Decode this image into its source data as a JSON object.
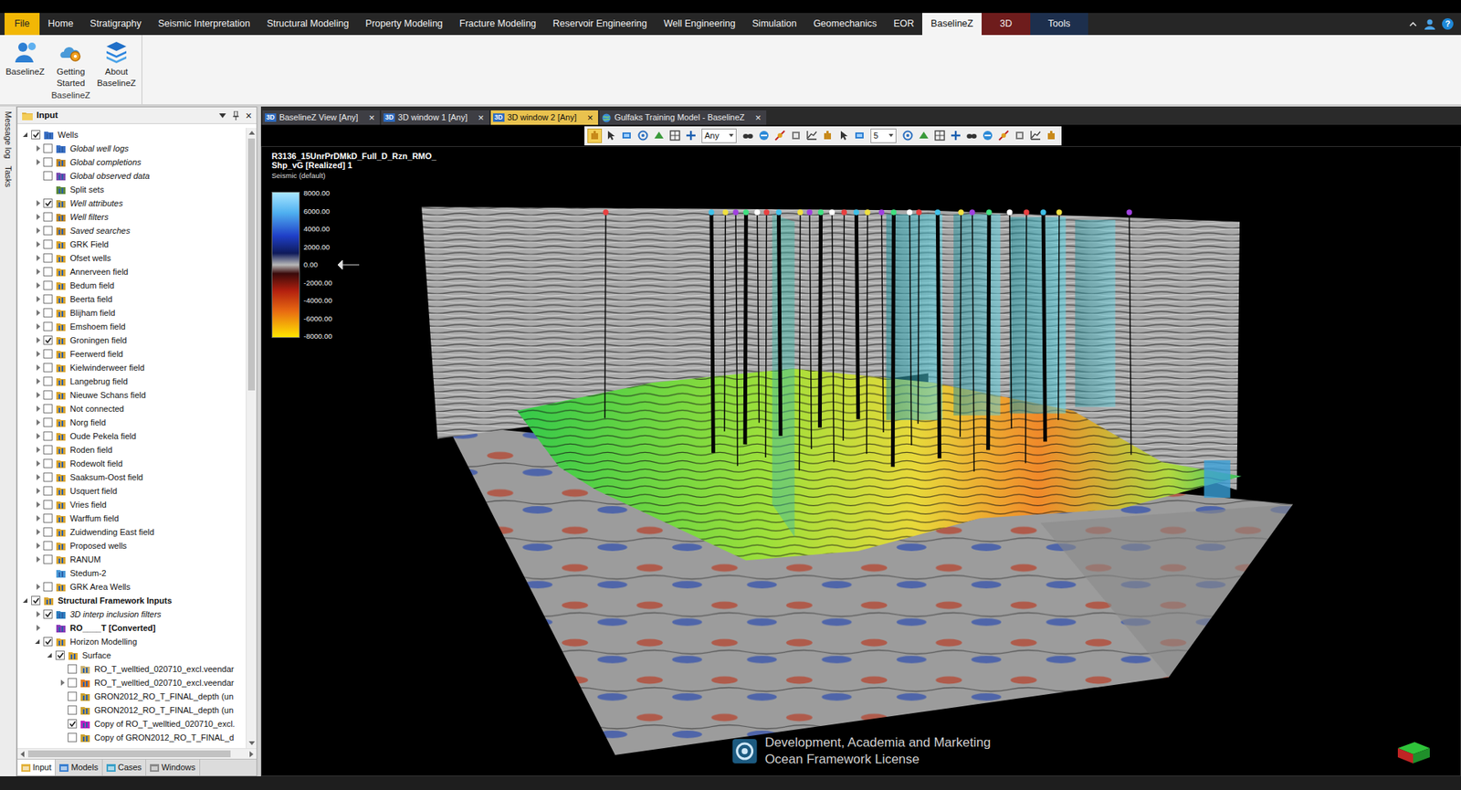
{
  "ribbon": {
    "tabs": [
      {
        "label": "File",
        "selected": false,
        "kind": "file"
      },
      {
        "label": "Home",
        "selected": false,
        "kind": "normal"
      },
      {
        "label": "Stratigraphy",
        "selected": false,
        "kind": "normal"
      },
      {
        "label": "Seismic Interpretation",
        "selected": false,
        "kind": "normal"
      },
      {
        "label": "Structural Modeling",
        "selected": false,
        "kind": "normal"
      },
      {
        "label": "Property Modeling",
        "selected": false,
        "kind": "normal"
      },
      {
        "label": "Fracture Modeling",
        "selected": false,
        "kind": "normal"
      },
      {
        "label": "Reservoir Engineering",
        "selected": false,
        "kind": "normal"
      },
      {
        "label": "Well Engineering",
        "selected": false,
        "kind": "normal"
      },
      {
        "label": "Simulation",
        "selected": false,
        "kind": "normal"
      },
      {
        "label": "Geomechanics",
        "selected": false,
        "kind": "normal"
      },
      {
        "label": "EOR",
        "selected": false,
        "kind": "normal"
      },
      {
        "label": "BaselineZ",
        "selected": true,
        "kind": "normal"
      },
      {
        "label": "3D",
        "selected": false,
        "kind": "context-red"
      },
      {
        "label": "Tools",
        "selected": false,
        "kind": "context-blue"
      }
    ],
    "help": "?",
    "group": {
      "label": "BaselineZ",
      "buttons": [
        {
          "label": "BaselineZ"
        },
        {
          "label": "Getting Started"
        },
        {
          "label": "About BaselineZ"
        }
      ]
    }
  },
  "side_strip": [
    "Message log",
    "Tasks"
  ],
  "input_panel": {
    "title": "Input",
    "close": "×",
    "tree": [
      {
        "label": "Wells",
        "depth": 0,
        "expander": "expanded",
        "has_checkbox": true,
        "checked": true,
        "style": "normal",
        "color": "#3a6fc4"
      },
      {
        "label": "Global well logs",
        "depth": 1,
        "expander": "collapsed",
        "has_checkbox": true,
        "checked": false,
        "style": "italic",
        "color": "#3a6fc4"
      },
      {
        "label": "Global completions",
        "depth": 1,
        "expander": "collapsed",
        "has_checkbox": true,
        "checked": false,
        "style": "italic",
        "color": "#c08a2a"
      },
      {
        "label": "Global observed data",
        "depth": 1,
        "expander": "none",
        "has_checkbox": true,
        "checked": false,
        "style": "italic",
        "color": "#7a4bb0"
      },
      {
        "label": "Split sets",
        "depth": 1,
        "expander": "none",
        "has_checkbox": false,
        "checked": false,
        "style": "normal",
        "color": "#5d8a3a"
      },
      {
        "label": "Well attributes",
        "depth": 1,
        "expander": "collapsed",
        "has_checkbox": true,
        "checked": true,
        "style": "italic",
        "color": "#c0a040"
      },
      {
        "label": "Well filters",
        "depth": 1,
        "expander": "collapsed",
        "has_checkbox": true,
        "checked": false,
        "style": "italic",
        "color": "#c08a2a"
      },
      {
        "label": "Saved searches",
        "depth": 1,
        "expander": "collapsed",
        "has_checkbox": true,
        "checked": false,
        "style": "italic",
        "color": "#c08a2a"
      },
      {
        "label": "GRK Field",
        "depth": 1,
        "expander": "collapsed",
        "has_checkbox": true,
        "checked": false,
        "style": "normal",
        "color": "#d9a531"
      },
      {
        "label": "Ofset wells",
        "depth": 1,
        "expander": "collapsed",
        "has_checkbox": true,
        "checked": false,
        "style": "normal",
        "color": "#d9a531"
      },
      {
        "label": "Annerveen field",
        "depth": 1,
        "expander": "collapsed",
        "has_checkbox": true,
        "checked": false,
        "style": "normal",
        "color": "#d9a531"
      },
      {
        "label": "Bedum field",
        "depth": 1,
        "expander": "collapsed",
        "has_checkbox": true,
        "checked": false,
        "style": "normal",
        "color": "#d9a531"
      },
      {
        "label": "Beerta field",
        "depth": 1,
        "expander": "collapsed",
        "has_checkbox": true,
        "checked": false,
        "style": "normal",
        "color": "#d9a531"
      },
      {
        "label": "Blijham field",
        "depth": 1,
        "expander": "collapsed",
        "has_checkbox": true,
        "checked": false,
        "style": "normal",
        "color": "#d9a531"
      },
      {
        "label": "Emshoem field",
        "depth": 1,
        "expander": "collapsed",
        "has_checkbox": true,
        "checked": false,
        "style": "normal",
        "color": "#d9a531"
      },
      {
        "label": "Groningen field",
        "depth": 1,
        "expander": "collapsed",
        "has_checkbox": true,
        "checked": true,
        "style": "normal",
        "color": "#d9a531"
      },
      {
        "label": "Feerwerd field",
        "depth": 1,
        "expander": "collapsed",
        "has_checkbox": true,
        "checked": false,
        "style": "normal",
        "color": "#d9a531"
      },
      {
        "label": "Kielwinderweer field",
        "depth": 1,
        "expander": "collapsed",
        "has_checkbox": true,
        "checked": false,
        "style": "normal",
        "color": "#d9a531"
      },
      {
        "label": "Langebrug field",
        "depth": 1,
        "expander": "collapsed",
        "has_checkbox": true,
        "checked": false,
        "style": "normal",
        "color": "#d9a531"
      },
      {
        "label": "Nieuwe Schans field",
        "depth": 1,
        "expander": "collapsed",
        "has_checkbox": true,
        "checked": false,
        "style": "normal",
        "color": "#d9a531"
      },
      {
        "label": "Not connected",
        "depth": 1,
        "expander": "collapsed",
        "has_checkbox": true,
        "checked": false,
        "style": "normal",
        "color": "#d9a531"
      },
      {
        "label": "Norg field",
        "depth": 1,
        "expander": "collapsed",
        "has_checkbox": true,
        "checked": false,
        "style": "normal",
        "color": "#d9a531"
      },
      {
        "label": "Oude Pekela field",
        "depth": 1,
        "expander": "collapsed",
        "has_checkbox": true,
        "checked": false,
        "style": "normal",
        "color": "#d9a531"
      },
      {
        "label": "Roden field",
        "depth": 1,
        "expander": "collapsed",
        "has_checkbox": true,
        "checked": false,
        "style": "normal",
        "color": "#d9a531"
      },
      {
        "label": "Rodewolt field",
        "depth": 1,
        "expander": "collapsed",
        "has_checkbox": true,
        "checked": false,
        "style": "normal",
        "color": "#d9a531"
      },
      {
        "label": "Saaksum-Oost field",
        "depth": 1,
        "expander": "collapsed",
        "has_checkbox": true,
        "checked": false,
        "style": "normal",
        "color": "#d9a531"
      },
      {
        "label": "Usquert field",
        "depth": 1,
        "expander": "collapsed",
        "has_checkbox": true,
        "checked": false,
        "style": "normal",
        "color": "#d9a531"
      },
      {
        "label": "Vries field",
        "depth": 1,
        "expander": "collapsed",
        "has_checkbox": true,
        "checked": false,
        "style": "normal",
        "color": "#d9a531"
      },
      {
        "label": "Warffum field",
        "depth": 1,
        "expander": "collapsed",
        "has_checkbox": true,
        "checked": false,
        "style": "normal",
        "color": "#d9a531"
      },
      {
        "label": "Zuidwending East field",
        "depth": 1,
        "expander": "collapsed",
        "has_checkbox": true,
        "checked": false,
        "style": "normal",
        "color": "#d9a531"
      },
      {
        "label": "Proposed wells",
        "depth": 1,
        "expander": "collapsed",
        "has_checkbox": true,
        "checked": false,
        "style": "normal",
        "color": "#d9a531"
      },
      {
        "label": "RANUM",
        "depth": 1,
        "expander": "collapsed",
        "has_checkbox": true,
        "checked": false,
        "style": "normal",
        "color": "#d9a531"
      },
      {
        "label": "Stedum-2",
        "depth": 1,
        "expander": "none",
        "has_checkbox": false,
        "checked": false,
        "style": "normal",
        "color": "#4a9ad8"
      },
      {
        "label": "GRK Area  Wells",
        "depth": 1,
        "expander": "collapsed",
        "has_checkbox": true,
        "checked": false,
        "style": "normal",
        "color": "#d9a531"
      },
      {
        "label": "Structural Framework Inputs",
        "depth": 0,
        "expander": "expanded",
        "has_checkbox": true,
        "checked": true,
        "style": "bold",
        "color": "#d9a531"
      },
      {
        "label": "3D interp inclusion filters",
        "depth": 1,
        "expander": "collapsed",
        "has_checkbox": true,
        "checked": true,
        "style": "italic",
        "color": "#2e7fbf"
      },
      {
        "label": "RO____T [Converted]",
        "depth": 1,
        "expander": "collapsed",
        "has_checkbox": false,
        "checked": false,
        "style": "bold",
        "color": "#8a3ab8"
      },
      {
        "label": "Horizon Modelling",
        "depth": 1,
        "expander": "expanded",
        "has_checkbox": true,
        "checked": true,
        "style": "normal",
        "color": "#d9a531"
      },
      {
        "label": "Surface",
        "depth": 2,
        "expander": "expanded",
        "has_checkbox": true,
        "checked": true,
        "style": "normal",
        "color": "#d9a531"
      },
      {
        "label": "RO_T_welltied_020710_excl.veendar",
        "depth": 3,
        "expander": "none",
        "has_checkbox": true,
        "checked": false,
        "style": "normal",
        "color": "#c9b070"
      },
      {
        "label": "RO_T_welltied_020710_excl.veendar",
        "depth": 3,
        "expander": "collapsed",
        "has_checkbox": true,
        "checked": false,
        "style": "normal",
        "color": "#e07b20"
      },
      {
        "label": "GRON2012_RO_T_FINAL_depth (un",
        "depth": 3,
        "expander": "none",
        "has_checkbox": true,
        "checked": false,
        "style": "normal",
        "color": "#c9a030"
      },
      {
        "label": "GRON2012_RO_T_FINAL_depth (un",
        "depth": 3,
        "expander": "none",
        "has_checkbox": true,
        "checked": false,
        "style": "normal",
        "color": "#c9a030"
      },
      {
        "label": "Copy of RO_T_welltied_020710_excl.",
        "depth": 3,
        "expander": "none",
        "has_checkbox": true,
        "checked": true,
        "style": "normal",
        "color": "#c020c0"
      },
      {
        "label": "Copy of GRON2012_RO_T_FINAL_d",
        "depth": 3,
        "expander": "none",
        "has_checkbox": true,
        "checked": false,
        "style": "normal",
        "color": "#c9a030"
      }
    ],
    "scrollbar": {
      "level": 0.42
    },
    "hscrollbar": {
      "level": 0.93
    },
    "tabs": [
      {
        "label": "Input",
        "selected": true
      },
      {
        "label": "Models",
        "selected": false
      },
      {
        "label": "Cases",
        "selected": false
      },
      {
        "label": "Windows",
        "selected": false
      }
    ]
  },
  "doc_tabs": [
    {
      "label": "BaselineZ View [Any]",
      "badge": "3D",
      "kind": "3d",
      "selected": false,
      "close": "×"
    },
    {
      "label": "3D window 1 [Any]",
      "badge": "3D",
      "kind": "3d",
      "selected": false,
      "close": "×"
    },
    {
      "label": "3D window 2 [Any]",
      "badge": "3D",
      "kind": "3d",
      "selected": true,
      "close": "×"
    },
    {
      "label": "Gulfaks Training Model - BaselineZ",
      "badge": "",
      "kind": "model",
      "selected": false,
      "close": "×"
    }
  ],
  "toolbar": {
    "tools_a": [
      {
        "selected": true
      },
      {
        "selected": false
      },
      {
        "selected": false
      },
      {
        "selected": false
      },
      {
        "selected": false
      },
      {
        "selected": false
      },
      {
        "selected": false
      }
    ],
    "dropdown_a": {
      "value": "Any"
    },
    "tools_b": [
      {
        "selected": false
      },
      {
        "selected": false
      },
      {
        "selected": false
      },
      {
        "selected": false
      },
      {
        "selected": false
      },
      {
        "selected": false
      },
      {
        "selected": false
      },
      {
        "selected": false
      }
    ],
    "dropdown_b": {
      "value": "5"
    },
    "tools_c": [
      {
        "selected": false
      },
      {
        "selected": false
      },
      {
        "selected": false
      },
      {
        "selected": false
      },
      {
        "selected": false
      },
      {
        "selected": false
      },
      {
        "selected": false
      },
      {
        "selected": false
      },
      {
        "selected": false
      },
      {
        "selected": false
      }
    ]
  },
  "viewport": {
    "legend": {
      "title_lines": [
        "R3136_15UnrPrDMkD_Full_D_Rzn_RMO_",
        "Shp_vG [Realized] 1"
      ],
      "subtitle": "Seismic (default)",
      "ticks": [
        "8000.00",
        "6000.00",
        "4000.00",
        "2000.00",
        "0.00",
        "-2000.00",
        "-4000.00",
        "-6000.00",
        "-8000.00"
      ]
    },
    "watermark": [
      "Development, Academia and Marketing",
      "Ocean Framework License"
    ]
  }
}
